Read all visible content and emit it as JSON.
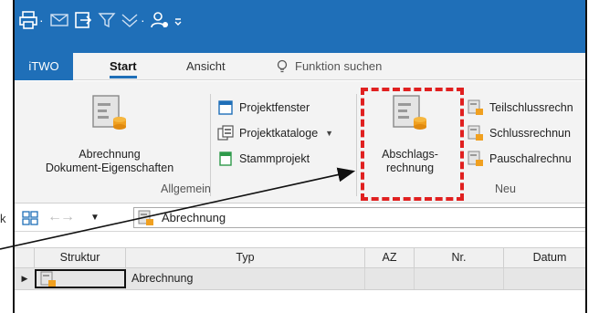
{
  "quick_access": {
    "icons": [
      "print-icon",
      "mail-icon",
      "export-icon",
      "filter-icon",
      "collapse-icon",
      "user-add-icon",
      "customize-icon"
    ]
  },
  "tabs": {
    "app": "iTWO",
    "start": "Start",
    "view": "Ansicht",
    "search": "Funktion suchen"
  },
  "ribbon": {
    "doc_props": {
      "line1": "Abrechnung",
      "line2": "Dokument-Eigenschaften"
    },
    "group_general": "Allgemein",
    "small_buttons": {
      "project_window": "Projektfenster",
      "project_catalogs": "Projektkataloge",
      "master_project": "Stammprojekt"
    },
    "partial_invoice": {
      "line1": "Abschlags-",
      "line2": "rechnung"
    },
    "group_new": "Neu",
    "right_buttons": {
      "partial_final": "Teilschlussrechn",
      "final": "Schlussrechnun",
      "lump_sum": "Pauschalrechnu"
    }
  },
  "toolbar": {
    "field_value": "Abrechnung"
  },
  "grid": {
    "columns": [
      "Struktur",
      "Typ",
      "AZ",
      "Nr.",
      "Datum"
    ],
    "rows": [
      {
        "struktur": "",
        "typ": "Abrechnung",
        "az": "",
        "nr": "",
        "datum": ""
      }
    ]
  },
  "outside": {
    "left_char": "k"
  },
  "colors": {
    "accent": "#1f6fb8",
    "highlight": "#e02020"
  }
}
